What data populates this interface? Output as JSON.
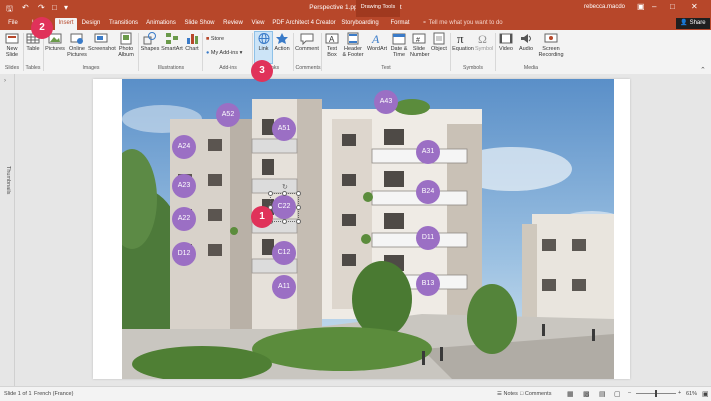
{
  "titlebar": {
    "title": "Perspective 1.pptx - PowerPoint",
    "context_group": "Drawing Tools",
    "user": "rebecca.macdo"
  },
  "tabs": [
    "File",
    "Home",
    "Insert",
    "Design",
    "Transitions",
    "Animations",
    "Slide Show",
    "Review",
    "View",
    "PDF Architect 4 Creator",
    "Storyboarding",
    "Format"
  ],
  "active_tab": "Insert",
  "tellme_placeholder": "Tell me what you want to do",
  "share_label": "Share",
  "ribbon": {
    "buttons": [
      {
        "label": "New Slide",
        "icon": "new-slide-icon"
      },
      {
        "label": "Table",
        "icon": "table-icon"
      },
      {
        "label": "Pictures",
        "icon": "pictures-icon"
      },
      {
        "label": "Online Pictures",
        "icon": "online-pictures-icon"
      },
      {
        "label": "Screenshot",
        "icon": "screenshot-icon"
      },
      {
        "label": "Photo Album",
        "icon": "photo-album-icon"
      },
      {
        "label": "Shapes",
        "icon": "shapes-icon"
      },
      {
        "label": "SmartArt",
        "icon": "smartart-icon"
      },
      {
        "label": "Chart",
        "icon": "chart-icon"
      },
      {
        "label": "Link",
        "icon": "link-icon"
      },
      {
        "label": "Action",
        "icon": "action-icon"
      },
      {
        "label": "Comment",
        "icon": "comment-icon"
      },
      {
        "label": "Text Box",
        "icon": "text-box-icon"
      },
      {
        "label": "Header & Footer",
        "icon": "header-footer-icon"
      },
      {
        "label": "WordArt",
        "icon": "wordart-icon"
      },
      {
        "label": "Date & Time",
        "icon": "date-time-icon"
      },
      {
        "label": "Slide Number",
        "icon": "slide-number-icon"
      },
      {
        "label": "Object",
        "icon": "object-icon"
      },
      {
        "label": "Equation",
        "icon": "equation-icon"
      },
      {
        "label": "Symbol",
        "icon": "symbol-icon"
      },
      {
        "label": "Video",
        "icon": "video-icon"
      },
      {
        "label": "Audio",
        "icon": "audio-icon"
      },
      {
        "label": "Screen Recording",
        "icon": "screen-recording-icon"
      }
    ],
    "addins": {
      "store": "Store",
      "my_addins": "My Add-ins"
    },
    "groups": [
      "Slides",
      "Tables",
      "Images",
      "Illustrations",
      "Add-ins",
      "Links",
      "Comments",
      "Text",
      "Symbols",
      "Media"
    ]
  },
  "side_pane_label": "Thumbnails",
  "markers": [
    "A43",
    "A52",
    "A51",
    "A24",
    "A31",
    "A23",
    "B24",
    "C22",
    "A22",
    "D11",
    "C12",
    "D12",
    "B13",
    "A11"
  ],
  "callouts": [
    "1",
    "2",
    "3"
  ],
  "status": {
    "slide": "Slide 1 of 1",
    "language": "French (France)",
    "notes": "Notes",
    "comments": "Comments",
    "zoom": "61%"
  },
  "colors": {
    "accent": "#b7472a",
    "marker": "#9b6fc4",
    "callout": "#e0325a"
  }
}
